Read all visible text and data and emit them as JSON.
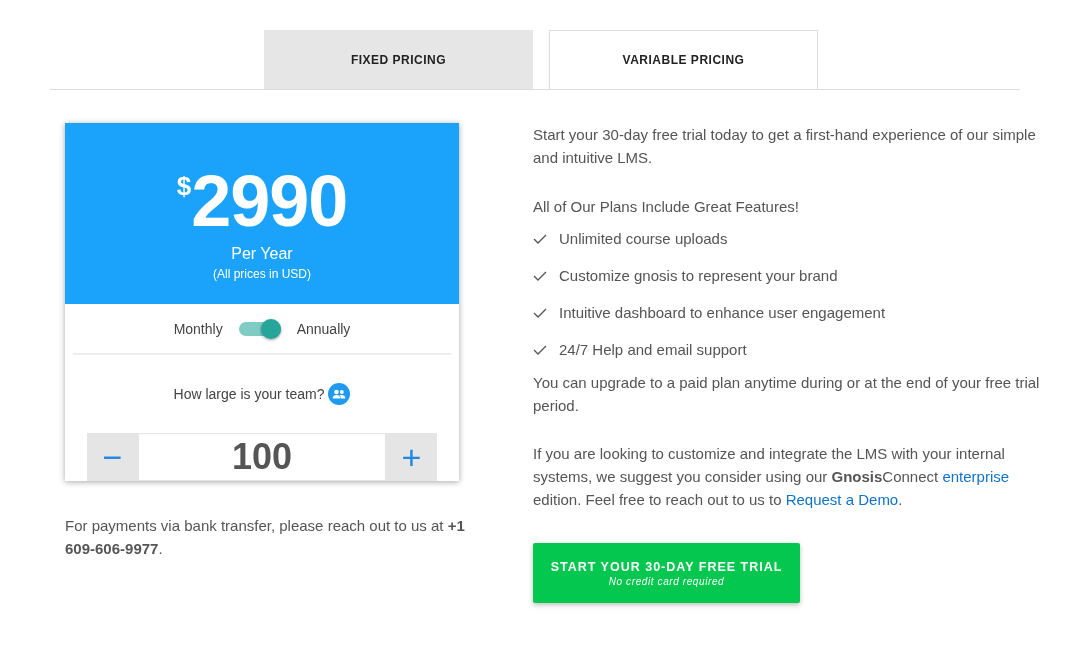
{
  "tabs": [
    {
      "label": "FIXED PRICING",
      "selected": true
    },
    {
      "label": "VARIABLE PRICING",
      "selected": false
    }
  ],
  "price_card": {
    "currency": "$",
    "amount": "2990",
    "period": "Per Year",
    "note": "(All prices in USD)",
    "billing": {
      "left_label": "Monthly",
      "right_label": "Annually",
      "on": true
    },
    "team_question": "How large is your team?",
    "team_size": {
      "minus": "−",
      "value": "100",
      "plus": "+"
    }
  },
  "bank_note": "For payments via bank transfer, please reach out to us at **+1 609-606-9977**.",
  "intro": "Start your 30-day free trial today to get a first-hand experience of our simple and intuitive LMS.",
  "features_heading": "All of Our Plans Include Great Features!",
  "features": [
    "Unlimited course uploads",
    "Customize gnosis to represent your brand",
    "Intuitive dashboard to enhance user engagement",
    "24/7 Help and email support"
  ],
  "upgrade_note": "You can upgrade to a paid plan anytime during or at the end of your free trial period.",
  "enterprise_paragraph": [
    {
      "kind": "text",
      "text": "If you are looking to customize and integrate the LMS with your internal systems, we suggest you consider using our **Gnosis**Connect "
    },
    {
      "kind": "link",
      "text": "enterprise"
    },
    {
      "kind": "text",
      "text": " edition. Feel free to reach out to us to "
    },
    {
      "kind": "link",
      "text": "Request a Demo"
    },
    {
      "kind": "text",
      "text": "."
    }
  ],
  "trial_button": {
    "label": "START YOUR 30-DAY FREE TRIAL",
    "sublabel": "No credit card required"
  }
}
